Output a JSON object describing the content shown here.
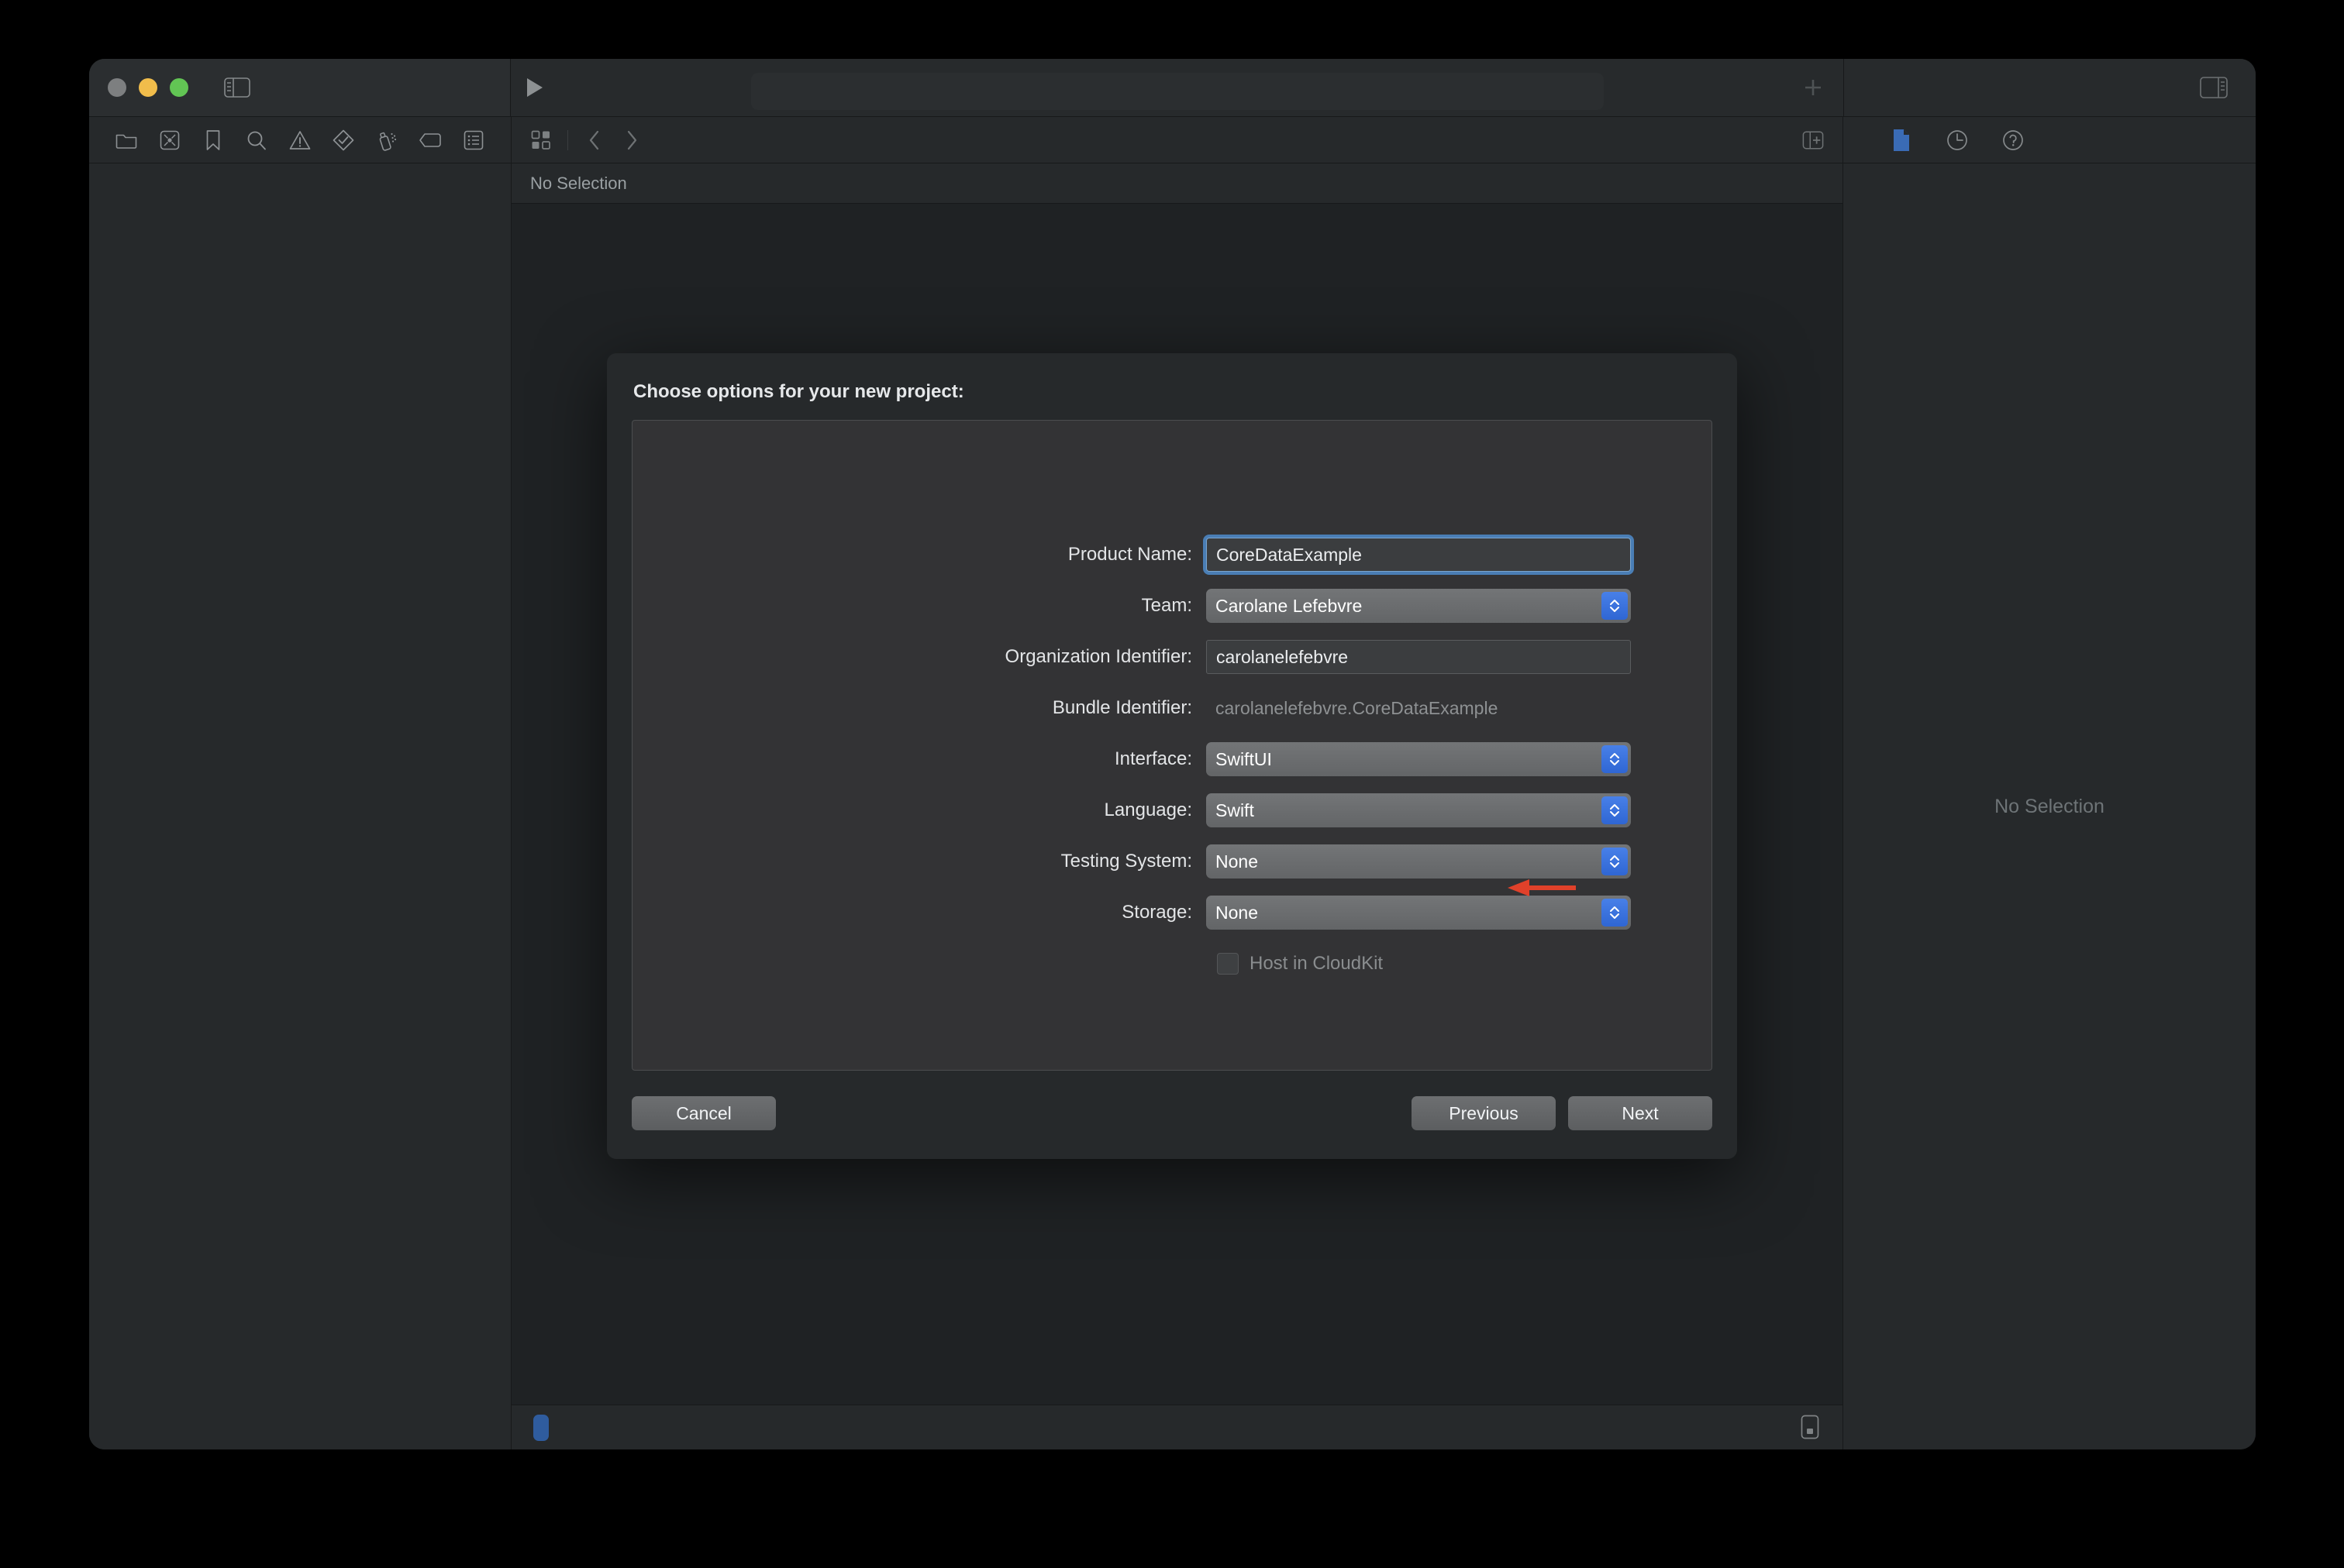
{
  "window": {
    "traffic_lights": [
      "close",
      "minimize",
      "maximize"
    ],
    "navigator_icons": [
      "folder-icon",
      "source-control-icon",
      "bookmark-icon",
      "search-icon",
      "warning-icon",
      "test-diamond-icon",
      "debug-spray-icon",
      "tag-icon",
      "report-icon"
    ],
    "jumpbar": {
      "grid_icon": "grid-icon",
      "back_icon": "chevron-left-icon",
      "forward_icon": "chevron-right-icon",
      "add_editor_icon": "add-editor-icon"
    },
    "breadcrumb": "No Selection",
    "inspector": {
      "icons": [
        "file-inspector-icon",
        "history-inspector-icon",
        "help-inspector-icon"
      ],
      "active_icon_color": "#3a6bb5",
      "empty_text": "No Selection"
    },
    "statusbar": {
      "indicator_color": "#2f5c9e",
      "console_icon": "console-icon"
    }
  },
  "sheet": {
    "title": "Choose options for your new project:",
    "fields": [
      {
        "label": "Product Name:",
        "type": "textfield",
        "value": "CoreDataExample",
        "focused": true
      },
      {
        "label": "Team:",
        "type": "popup",
        "value": "Carolane Lefebvre"
      },
      {
        "label": "Organization Identifier:",
        "type": "textfield",
        "value": "carolanelefebvre",
        "focused": false
      },
      {
        "label": "Bundle Identifier:",
        "type": "static",
        "value": "carolanelefebvre.CoreDataExample"
      },
      {
        "label": "Interface:",
        "type": "popup",
        "value": "SwiftUI"
      },
      {
        "label": "Language:",
        "type": "popup",
        "value": "Swift"
      },
      {
        "label": "Testing System:",
        "type": "popup",
        "value": "None"
      },
      {
        "label": "Storage:",
        "type": "popup",
        "value": "None"
      }
    ],
    "checkbox": {
      "label": "Host in CloudKit",
      "checked": false,
      "enabled": false
    },
    "buttons": {
      "cancel": "Cancel",
      "previous": "Previous",
      "next": "Next"
    }
  },
  "annotation": {
    "arrow_color": "#e0412a",
    "points_to": "Storage:"
  }
}
